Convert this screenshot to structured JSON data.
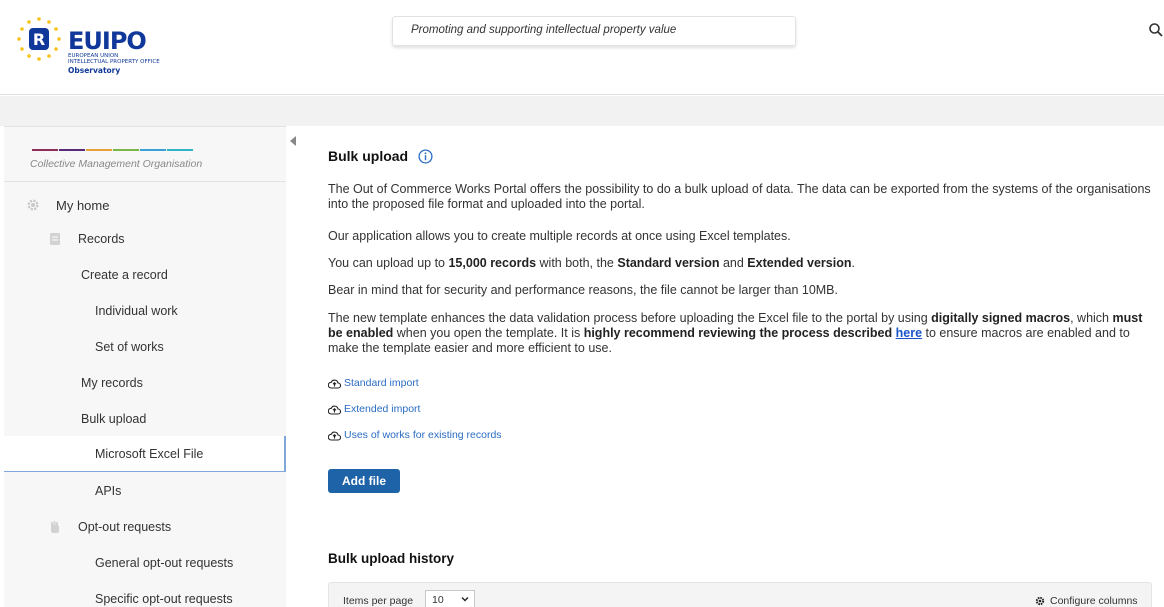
{
  "header": {
    "logo_word": "EUIPO",
    "logo_sub_line1": "EUROPEAN UNION",
    "logo_sub_line2": "INTELLECTUAL PROPERTY OFFICE",
    "logo_observatory": "Observatory",
    "tagline": "Promoting and supporting intellectual property value",
    "search_icon": "search-icon"
  },
  "sidebar": {
    "org_label": "Collective Management Organisation",
    "color_bar": [
      "#8c2f5a",
      "#5a2a7a",
      "#e8a23c",
      "#7ab648",
      "#3aa0d8",
      "#2fb5c9"
    ],
    "collapse_icon": "chevron-left-icon",
    "items": [
      {
        "label": "My home",
        "icon": "gear-icon"
      },
      {
        "label": "Records",
        "icon": "document-icon"
      },
      {
        "label": "Create a record"
      },
      {
        "label": "Individual work"
      },
      {
        "label": "Set of works"
      },
      {
        "label": "My records"
      },
      {
        "label": "Bulk upload"
      },
      {
        "label": "Microsoft Excel File"
      },
      {
        "label": "APIs"
      },
      {
        "label": "Opt-out requests",
        "icon": "hand-icon"
      },
      {
        "label": "General opt-out requests"
      },
      {
        "label": "Specific opt-out requests"
      }
    ]
  },
  "main": {
    "title": "Bulk upload",
    "info_icon": "info-icon",
    "p1": "The Out of Commerce Works Portal offers the possibility to do a bulk upload of data. The data can be exported from the systems of the organisations into the proposed file format and uploaded into the portal.",
    "p2": "Our application allows you to create multiple records at once using Excel templates.",
    "p3_a": "You can upload up to ",
    "p3_b": "15,000 records",
    "p3_c": " with both, the ",
    "p3_d": "Standard version",
    "p3_e": " and ",
    "p3_f": "Extended version",
    "p3_g": ".",
    "p4": "Bear in mind that for security and performance reasons, the file cannot be larger than 10MB.",
    "p5_a": "The new template enhances the data validation process before uploading the Excel file to the portal by using ",
    "p5_b": "digitally signed macros",
    "p5_c": ", which ",
    "p5_d": "must be enabled",
    "p5_e": " when you open the template. It is ",
    "p5_f": "highly recommend reviewing the process described",
    "p5_g": " ",
    "p5_link": "here",
    "p5_h": " to ensure macros are enabled and to make the template easier and more efficient to use.",
    "downloads": [
      "Standard import",
      "Extended import",
      "Uses of works for existing records"
    ],
    "download_icon": "cloud-upload-icon",
    "add_file": "Add file",
    "history_title": "Bulk upload history",
    "items_per_page_label": "Items per page",
    "items_per_page_value": "10",
    "configure_columns": "Configure columns",
    "configure_icon": "gear-icon"
  },
  "colors": {
    "brand_blue": "#10389a",
    "button_blue": "#1e63a8",
    "link_blue": "#2b6cc4"
  }
}
